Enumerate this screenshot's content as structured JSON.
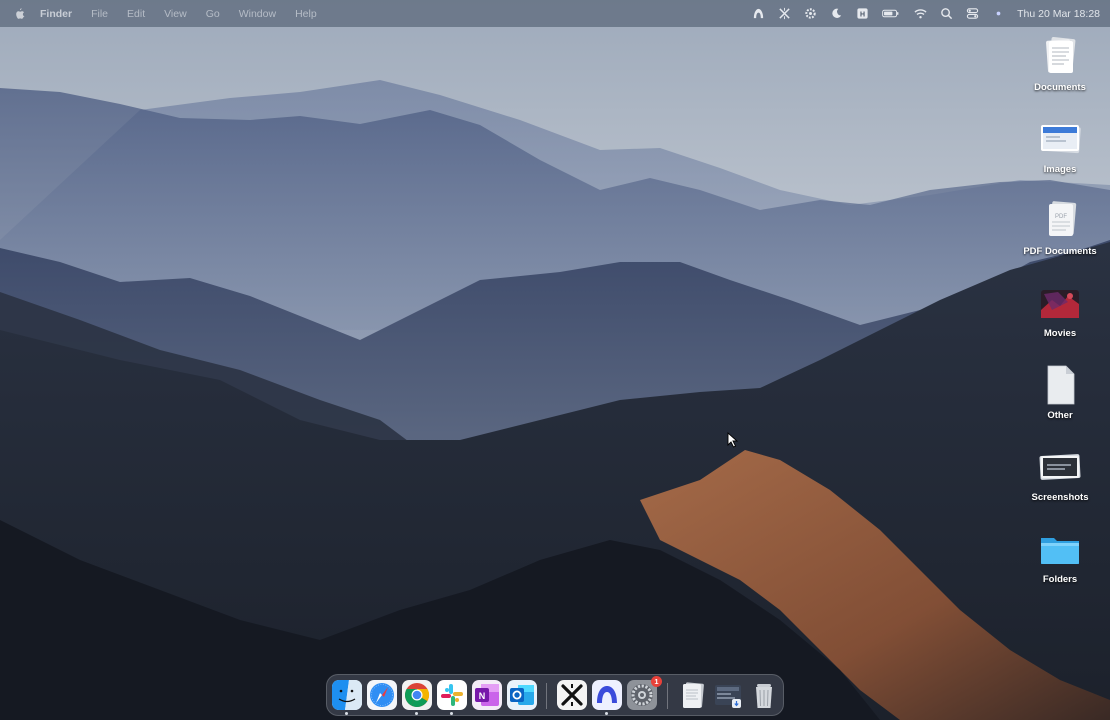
{
  "menubar": {
    "app_name": "Finder",
    "menus": [
      "File",
      "Edit",
      "View",
      "Go",
      "Window",
      "Help"
    ],
    "clock": "Thu 20 Mar  18:28",
    "status_icons": [
      "vpn-arch-icon",
      "capcut-x-icon",
      "gear-status-icon",
      "moon-focus-icon",
      "keyboard-input-icon",
      "battery-icon",
      "wifi-icon",
      "spotlight-search-icon",
      "control-center-icon",
      "siri-dot-icon"
    ]
  },
  "desktop_icons": [
    {
      "label": "Documents",
      "icon": "document-stack-icon"
    },
    {
      "label": "Images",
      "icon": "image-stack-icon"
    },
    {
      "label": "PDF Documents",
      "icon": "pdf-stack-icon"
    },
    {
      "label": "Movies",
      "icon": "movie-stack-icon"
    },
    {
      "label": "Other",
      "icon": "blank-document-icon"
    },
    {
      "label": "Screenshots",
      "icon": "screenshot-stack-icon"
    },
    {
      "label": "Folders",
      "icon": "folder-icon"
    }
  ],
  "dock": {
    "apps": [
      {
        "name": "finder-icon",
        "running": true
      },
      {
        "name": "safari-icon",
        "running": false
      },
      {
        "name": "chrome-icon",
        "running": true
      },
      {
        "name": "slack-icon",
        "running": true
      },
      {
        "name": "onenote-icon",
        "running": false
      },
      {
        "name": "outlook-icon",
        "running": false
      },
      {
        "name": "capcut-icon",
        "running": false
      },
      {
        "name": "arc-icon",
        "running": true
      },
      {
        "name": "system-settings-icon",
        "running": false,
        "badge": "1"
      },
      {
        "name": "documents-stack-icon",
        "running": false
      },
      {
        "name": "downloads-stack-icon",
        "running": false
      },
      {
        "name": "trash-icon",
        "running": false
      }
    ]
  },
  "colors": {
    "menubar_bg": "#465264",
    "badge": "#e8413a",
    "folder_blue": "#42b4ef"
  }
}
